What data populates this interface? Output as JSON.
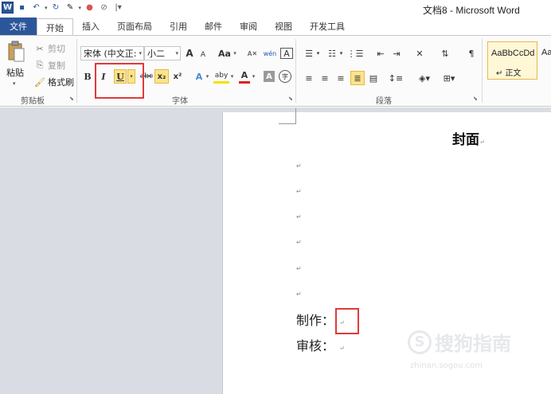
{
  "titlebar": {
    "app_icon": "W",
    "title": "文档8 - Microsoft Word"
  },
  "tabs": [
    {
      "label": "文件"
    },
    {
      "label": "开始"
    },
    {
      "label": "插入"
    },
    {
      "label": "页面布局"
    },
    {
      "label": "引用"
    },
    {
      "label": "邮件"
    },
    {
      "label": "审阅"
    },
    {
      "label": "视图"
    },
    {
      "label": "开发工具"
    }
  ],
  "clipboard": {
    "paste_label": "粘贴",
    "cut_label": "剪切",
    "copy_label": "复制",
    "format_painter_label": "格式刷",
    "group_label": "剪贴板"
  },
  "font": {
    "font_name": "宋体 (中文正:",
    "font_size": "小二",
    "grow": "A",
    "shrink": "A",
    "change_case": "Aa",
    "phonetic": "wén",
    "border_char": "A",
    "bold": "B",
    "italic": "I",
    "underline": "U",
    "strike": "abc",
    "subscript": "x₂",
    "superscript": "x²",
    "text_effects": "A",
    "highlight": "aby",
    "font_color": "A",
    "char_shading": "A",
    "enclosed": "字",
    "group_label": "字体"
  },
  "paragraph": {
    "group_label": "段落"
  },
  "styles": {
    "normal_sample": "AaBbCcDd",
    "normal_name": "↵ 正文",
    "next_sample": "Aa"
  },
  "document": {
    "title": "封面",
    "para_mark": "↵",
    "made_by": "制作：",
    "reviewed_by": "审核："
  },
  "watermark": {
    "text": "搜狗指南",
    "url": "zhinan.sogou.com"
  }
}
